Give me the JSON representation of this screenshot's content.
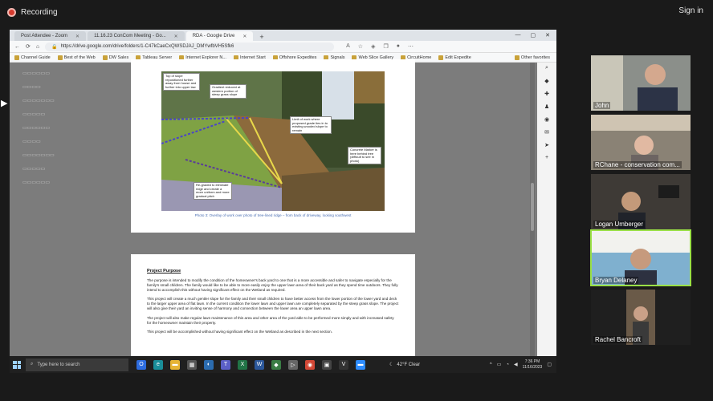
{
  "zoom": {
    "recording_label": "Recording",
    "signin_label": "Sign in"
  },
  "browser": {
    "tabs": [
      {
        "label": "Post Attendee - Zoom"
      },
      {
        "label": "11.16.23 ConCom Meeting - Go..."
      },
      {
        "label": "RDA - Google Drive",
        "active": true
      }
    ],
    "url": "https://drive.google.com/drive/folders/1-C47kCaeCxQWSDJAJ_DMYwfbVH5Sfk6",
    "favorites": [
      "Channel Guide",
      "Best of the Web",
      "DW Sales",
      "Tableau Server",
      "Internet Explorer N...",
      "Internet Start",
      "Offshore Expedites",
      "Signals",
      "Web Slice Gallery",
      "CircuitHome",
      "Edit Expedite"
    ],
    "other_favorites": "Other favorites"
  },
  "document": {
    "photo_notes": [
      "Top of slope repositioned further away from house and further into upper law",
      "Gradient reduced at western portion of steep grass slope",
      "Limit of work where proposed grade ties in to existing wooded slope to remain",
      "Concrete Marker is here behind tree (difficult to see in photo)",
      "Re-graded to eliminate ridge and create a more uniform and more gradual pitch"
    ],
    "photo_caption": "Photo 3: Overlay of work over photo of tree-lined ridge – from back of driveway, looking southwest",
    "purpose_heading": "Project Purpose",
    "paragraphs": [
      "The purpose is intended to modify the condition of the homeowner's back yard to one that is a more accessible and safer to navigate especially for the family's small children.   The family would like to be able to more easily enjoy the upper lawn area of their back yard as they spend time outdoors.   They fully intend to accomplish this without having significant effect on the Wetland as required.",
      "This project will create a much gentler slope for the family and their small children to have better access from the lower portion of the lower yard and deck to the larger upper area of flat lawn.   In the current condition the lower lawn and upper lawn are completely separated by the steep grass slope.   The project will also give their yard an inviting sense of harmony and connection between the lower area an upper lawn area.",
      "The project will also make regular lawn maintenance of this area and other area of the yard able to be performed more simply and with increased safety for the homeowner maintain their property.",
      "This project will be accomplished without having significant effect on the Wetland as described in the next section."
    ]
  },
  "taskbar": {
    "search_placeholder": "Type here to search",
    "weather": "42°F  Clear",
    "time": "7:36 PM",
    "date": "11/16/2023"
  },
  "participants": [
    {
      "name": "John"
    },
    {
      "name": "RChane - conservation com..."
    },
    {
      "name": "Logan Umberger"
    },
    {
      "name": "Bryan Delaney",
      "active": true
    },
    {
      "name": "Rachel Bancroft"
    }
  ]
}
